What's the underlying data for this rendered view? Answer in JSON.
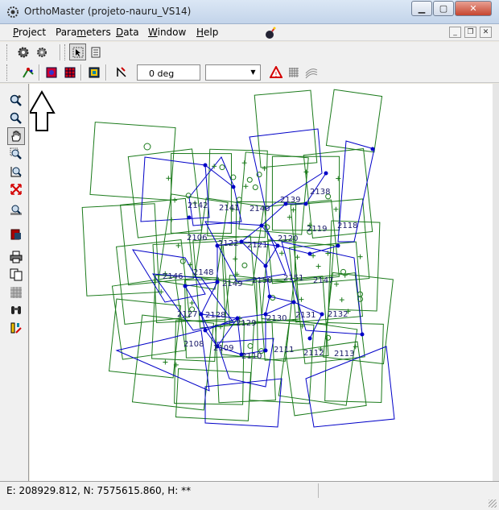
{
  "window": {
    "title": "OrthoMaster (projeto-nauru_VS14)",
    "app_icon": "orthomaster-gear-icon"
  },
  "menu": {
    "items": [
      {
        "label": "Project",
        "accel": "P",
        "rest": "roject"
      },
      {
        "label": "Parameters",
        "pre": "Para",
        "accel": "m",
        "rest": "eters"
      },
      {
        "label": "Data",
        "accel": "D",
        "rest": "ata"
      },
      {
        "label": "Window",
        "accel": "W",
        "rest": "indow"
      },
      {
        "label": "Help",
        "accel": "H",
        "rest": "elp"
      }
    ]
  },
  "toolbar": {
    "rotation_value": "0 deg",
    "combo_value": ""
  },
  "statusbar": {
    "coordinates": "E: 208929.812, N: 7575615.860, H: **",
    "pane2": ""
  },
  "map": {
    "line_color": "#0000c8",
    "footprint_color": "#1a7a1a",
    "photo_labels": [
      "2142",
      "2141",
      "2140",
      "2139",
      "2138",
      "2122",
      "2121",
      "2120",
      "2119",
      "2118",
      "2146",
      "2148",
      "2149",
      "2150",
      "2151",
      "2127",
      "2128",
      "2129",
      "2130",
      "2131",
      "2132",
      "2108",
      "2109",
      "2110",
      "2111",
      "2112",
      "2113",
      "2106",
      "2147"
    ],
    "north_arrow": "up-arrow-icon"
  },
  "colors": {
    "accent": "#0000c8",
    "footprint": "#1a7a1a",
    "warning": "#d40000"
  }
}
